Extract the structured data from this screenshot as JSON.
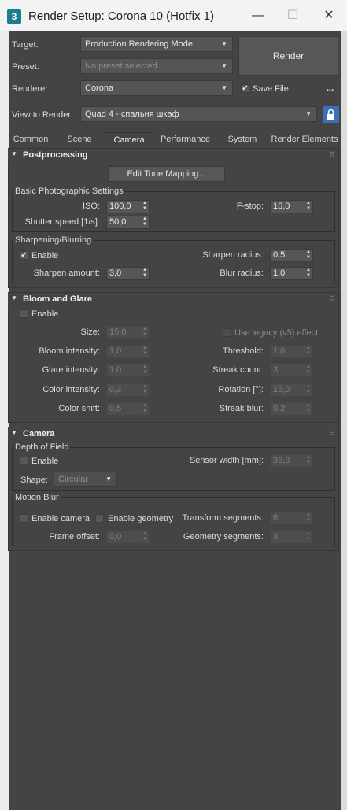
{
  "window": {
    "title": "Render Setup: Corona 10 (Hotfix 1)",
    "app_icon": "3"
  },
  "top": {
    "target_label": "Target:",
    "target_value": "Production Rendering Mode",
    "preset_label": "Preset:",
    "preset_value": "No preset selected",
    "renderer_label": "Renderer:",
    "renderer_value": "Corona",
    "render_button": "Render",
    "save_file_label": "Save File",
    "more_button": "...",
    "view_label": "View to Render:",
    "view_value": "Quad 4 - спальня шкаф"
  },
  "tabs": [
    "Common",
    "Scene",
    "Camera",
    "Performance",
    "System",
    "Render Elements"
  ],
  "active_tab": "Camera",
  "postprocessing": {
    "title": "Postprocessing",
    "edit_tone_mapping": "Edit Tone Mapping...",
    "basic_group": "Basic Photographic Settings",
    "iso_label": "ISO:",
    "iso_value": "100,0",
    "fstop_label": "F-stop:",
    "fstop_value": "16,0",
    "shutter_label": "Shutter speed [1/s]:",
    "shutter_value": "50,0",
    "sharpen_group": "Sharpening/Blurring",
    "enable_label": "Enable",
    "sharpen_radius_label": "Sharpen radius:",
    "sharpen_radius_value": "0,5",
    "sharpen_amount_label": "Sharpen amount:",
    "sharpen_amount_value": "3,0",
    "blur_radius_label": "Blur radius:",
    "blur_radius_value": "1,0"
  },
  "bloom": {
    "title": "Bloom and Glare",
    "enable_label": "Enable",
    "size_label": "Size:",
    "size_value": "15,0",
    "legacy_label": "Use legacy (v5) effect",
    "bloom_intensity_label": "Bloom intensity:",
    "bloom_intensity_value": "1,0",
    "threshold_label": "Threshold:",
    "threshold_value": "1,0",
    "glare_intensity_label": "Glare intensity:",
    "glare_intensity_value": "1,0",
    "streak_count_label": "Streak count:",
    "streak_count_value": "3",
    "color_intensity_label": "Color intensity:",
    "color_intensity_value": "0,3",
    "rotation_label": "Rotation [°]:",
    "rotation_value": "15,0",
    "color_shift_label": "Color shift:",
    "color_shift_value": "0,5",
    "streak_blur_label": "Streak blur:",
    "streak_blur_value": "0,2"
  },
  "camera": {
    "title": "Camera",
    "dof_group": "Depth of Field",
    "dof_enable_label": "Enable",
    "sensor_width_label": "Sensor width [mm]:",
    "sensor_width_value": "36,0",
    "shape_label": "Shape:",
    "shape_value": "Circular",
    "motion_group": "Motion Blur",
    "enable_camera_label": "Enable camera",
    "enable_geometry_label": "Enable geometry",
    "transform_segments_label": "Transform segments:",
    "transform_segments_value": "6",
    "frame_offset_label": "Frame offset:",
    "frame_offset_value": "0,0",
    "geometry_segments_label": "Geometry segments:",
    "geometry_segments_value": "3"
  },
  "colors": {
    "panel": "#444444",
    "field": "#565656",
    "lock_button": "#3c6fb5"
  }
}
